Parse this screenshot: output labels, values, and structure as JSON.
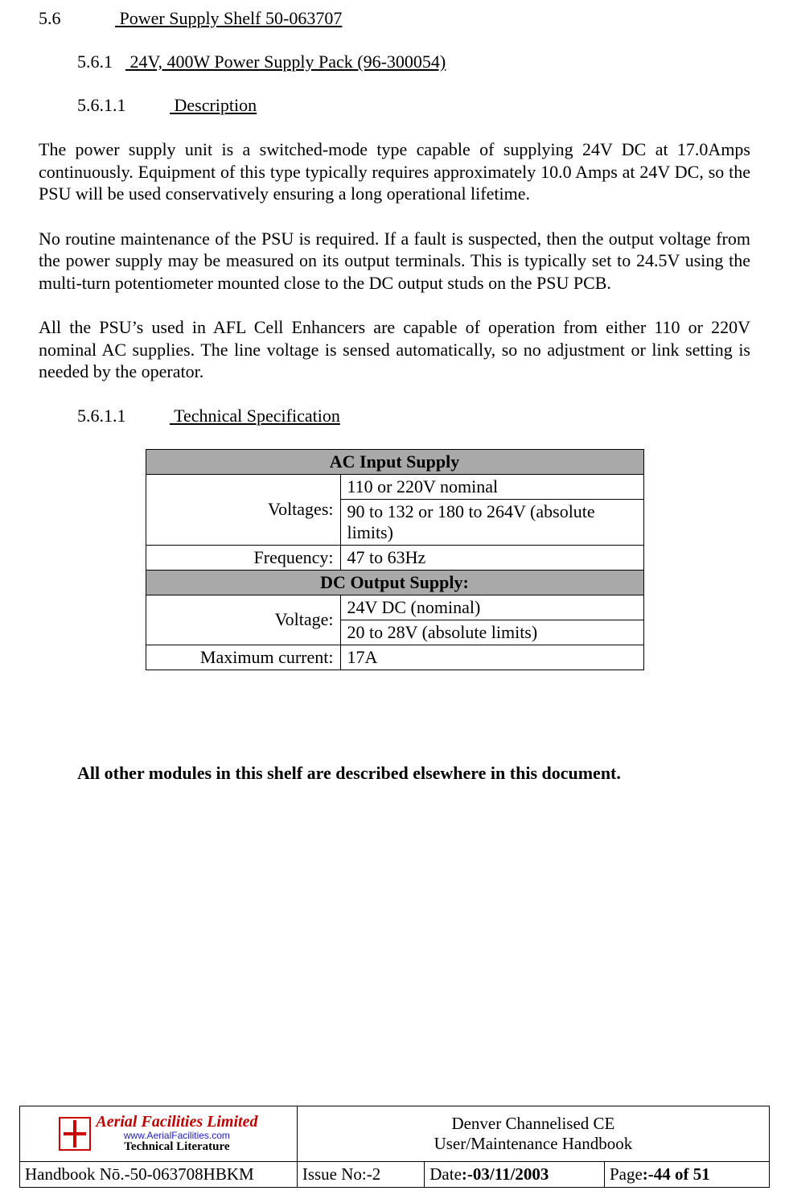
{
  "headings": {
    "h1_num": "5.6",
    "h1_text": "Power Supply Shelf 50-063707",
    "h2_num": "5.6.1",
    "h2_text": "24V, 400W Power Supply Pack (96-300054)",
    "h3a_num": "5.6.1.1",
    "h3a_text": "Description",
    "h3b_num": "5.6.1.1",
    "h3b_text": "Technical Specification"
  },
  "paragraphs": {
    "p1": "The power supply unit is a switched-mode type capable of supplying 24V DC at 17.0Amps continuously. Equipment of this type typically requires approximately 10.0 Amps at 24V DC, so the PSU will be used conservatively ensuring a long operational lifetime.",
    "p2": "No routine maintenance of the PSU is required. If a fault is suspected, then the output voltage from the power supply may be measured on its output terminals. This is typically set to 24.5V using the multi-turn potentiometer mounted close to the DC output studs on the PSU PCB.",
    "p3": "All the PSU’s used in AFL Cell Enhancers are capable of operation from either 110 or 220V nominal AC supplies. The line voltage is sensed automatically, so no adjustment or link setting is needed by the operator.",
    "closing": "All other modules in this shelf are described elsewhere in this document."
  },
  "spec_table": {
    "group1": "AC Input Supply",
    "r1_label": "Voltages:",
    "r1_v1": "110 or 220V nominal",
    "r1_v2": "90 to 132 or 180 to 264V (absolute limits)",
    "r2_label": "Frequency:",
    "r2_v": "47 to 63Hz",
    "group2": "DC Output Supply:",
    "r3_label": "Voltage:",
    "r3_v1": "24V DC (nominal)",
    "r3_v2": "20 to 28V (absolute limits)",
    "r4_label": "Maximum current:",
    "r4_v": "17A"
  },
  "footer": {
    "logo_line1": "Aerial  Facilities  Limited",
    "logo_line2": "www.AerialFacilities.com",
    "logo_line3": "Technical Literature",
    "doc_title_l1": "Denver Channelised CE",
    "doc_title_l2": "User/Maintenance Handbook",
    "hb_label": "Handbook Nō.-",
    "hb_value": "50-063708HBKM",
    "issue_label": "Issue No:-",
    "issue_value": "2",
    "date_label": "Date",
    "date_value": ":-03/11/2003",
    "page_label": "Page",
    "page_value": ":-44 of 51"
  }
}
